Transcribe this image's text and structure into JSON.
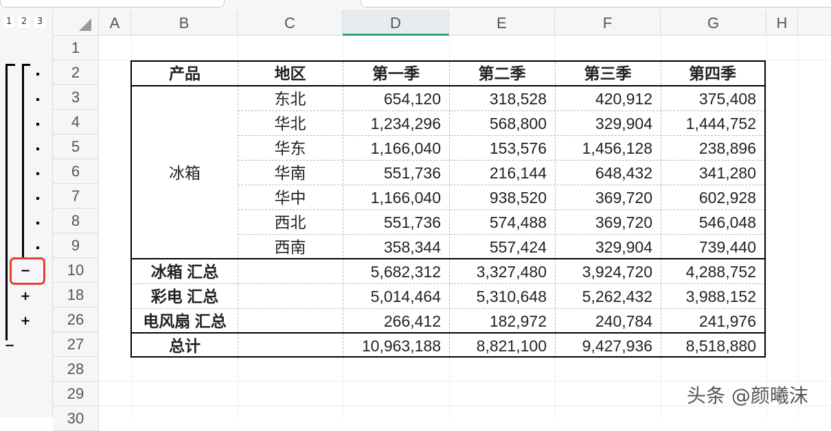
{
  "outline": {
    "levels": [
      "1",
      "2",
      "3"
    ],
    "buttons": {
      "collapse": "−",
      "expand": "+"
    }
  },
  "columns": [
    "A",
    "B",
    "C",
    "D",
    "E",
    "F",
    "G",
    "H"
  ],
  "active_column": "D",
  "row_numbers": [
    "1",
    "2",
    "3",
    "4",
    "5",
    "6",
    "7",
    "8",
    "9",
    "10",
    "18",
    "26",
    "27",
    "28",
    "29",
    "30"
  ],
  "table": {
    "headers": [
      "产品",
      "地区",
      "第一季",
      "第二季",
      "第三季",
      "第四季"
    ],
    "group_label": "冰箱",
    "detail_rows": [
      {
        "region": "东北",
        "q1": "654,120",
        "q2": "318,528",
        "q3": "420,912",
        "q4": "375,408"
      },
      {
        "region": "华北",
        "q1": "1,234,296",
        "q2": "568,800",
        "q3": "329,904",
        "q4": "1,444,752"
      },
      {
        "region": "华东",
        "q1": "1,166,040",
        "q2": "153,576",
        "q3": "1,456,128",
        "q4": "238,896"
      },
      {
        "region": "华南",
        "q1": "551,736",
        "q2": "216,144",
        "q3": "648,432",
        "q4": "341,280"
      },
      {
        "region": "华中",
        "q1": "1,166,040",
        "q2": "938,520",
        "q3": "369,720",
        "q4": "602,928"
      },
      {
        "region": "西北",
        "q1": "551,736",
        "q2": "574,488",
        "q3": "369,720",
        "q4": "546,048"
      },
      {
        "region": "西南",
        "q1": "358,344",
        "q2": "557,424",
        "q3": "329,904",
        "q4": "739,440"
      }
    ],
    "subtotal_rows": [
      {
        "label": "冰箱 汇总",
        "q1": "5,682,312",
        "q2": "3,327,480",
        "q3": "3,924,720",
        "q4": "4,288,752"
      },
      {
        "label": "彩电 汇总",
        "q1": "5,014,464",
        "q2": "5,310,648",
        "q3": "5,262,432",
        "q4": "3,988,152"
      },
      {
        "label": "电风扇 汇总",
        "q1": "266,412",
        "q2": "182,972",
        "q3": "240,784",
        "q4": "241,976"
      }
    ],
    "total_row": {
      "label": "总计",
      "q1": "10,963,188",
      "q2": "8,821,100",
      "q3": "9,427,936",
      "q4": "8,518,880"
    }
  },
  "watermark": "头条 @颜曦沫",
  "colors": {
    "accent": "#2fa372",
    "highlight": "#e0412e"
  }
}
